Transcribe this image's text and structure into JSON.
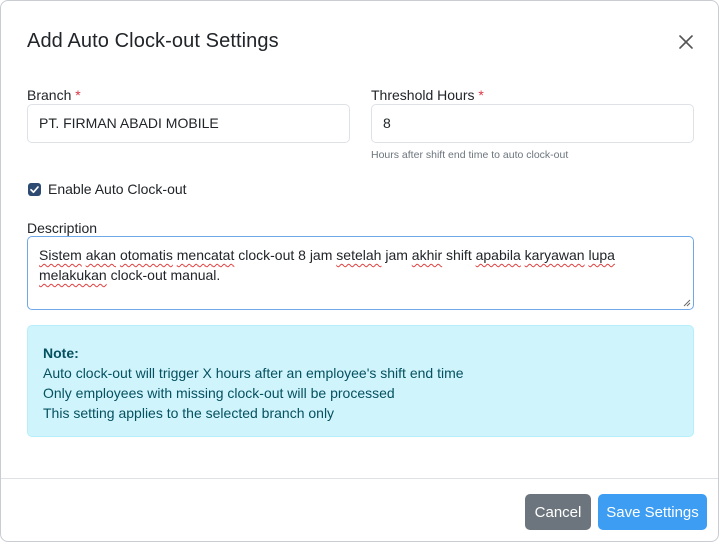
{
  "modal": {
    "title": "Add Auto Clock-out Settings"
  },
  "form": {
    "branch_label": "Branch",
    "branch_value": "PT. FIRMAN ABADI MOBILE",
    "threshold_label": "Threshold Hours",
    "threshold_value": "8",
    "threshold_help": "Hours after shift end time to auto clock-out",
    "required_marker": "*",
    "enable_label": "Enable Auto Clock-out",
    "enable_checked": true,
    "description_label": "Description",
    "description_words": {
      "w1": "Sistem",
      "w2": "akan",
      "w3": "otomatis",
      "w4": "mencatat",
      "w5": "clock-out 8 jam",
      "w6": "setelah",
      "w7": "jam",
      "w8": "akhir",
      "w9": "shift",
      "w10": "apabila",
      "w11": "karyawan",
      "w12": "lupa",
      "w13": "melakukan",
      "w14": "clock-out manual."
    }
  },
  "note": {
    "title": "Note:",
    "lines": [
      "Auto clock-out will trigger X hours after an employee's shift end time",
      "Only employees with missing clock-out will be processed",
      "This setting applies to the selected branch only"
    ]
  },
  "footer": {
    "cancel_label": "Cancel",
    "save_label": "Save Settings"
  },
  "colors": {
    "primary": "#3d9df3",
    "secondary": "#6c757d",
    "info_bg": "#cff4fc",
    "info_text": "#055160",
    "checkbox": "#2d4a73",
    "required": "#dc3545"
  },
  "icons": {
    "close": "close-icon",
    "check": "check-icon",
    "resize": "resize-grip-icon"
  }
}
